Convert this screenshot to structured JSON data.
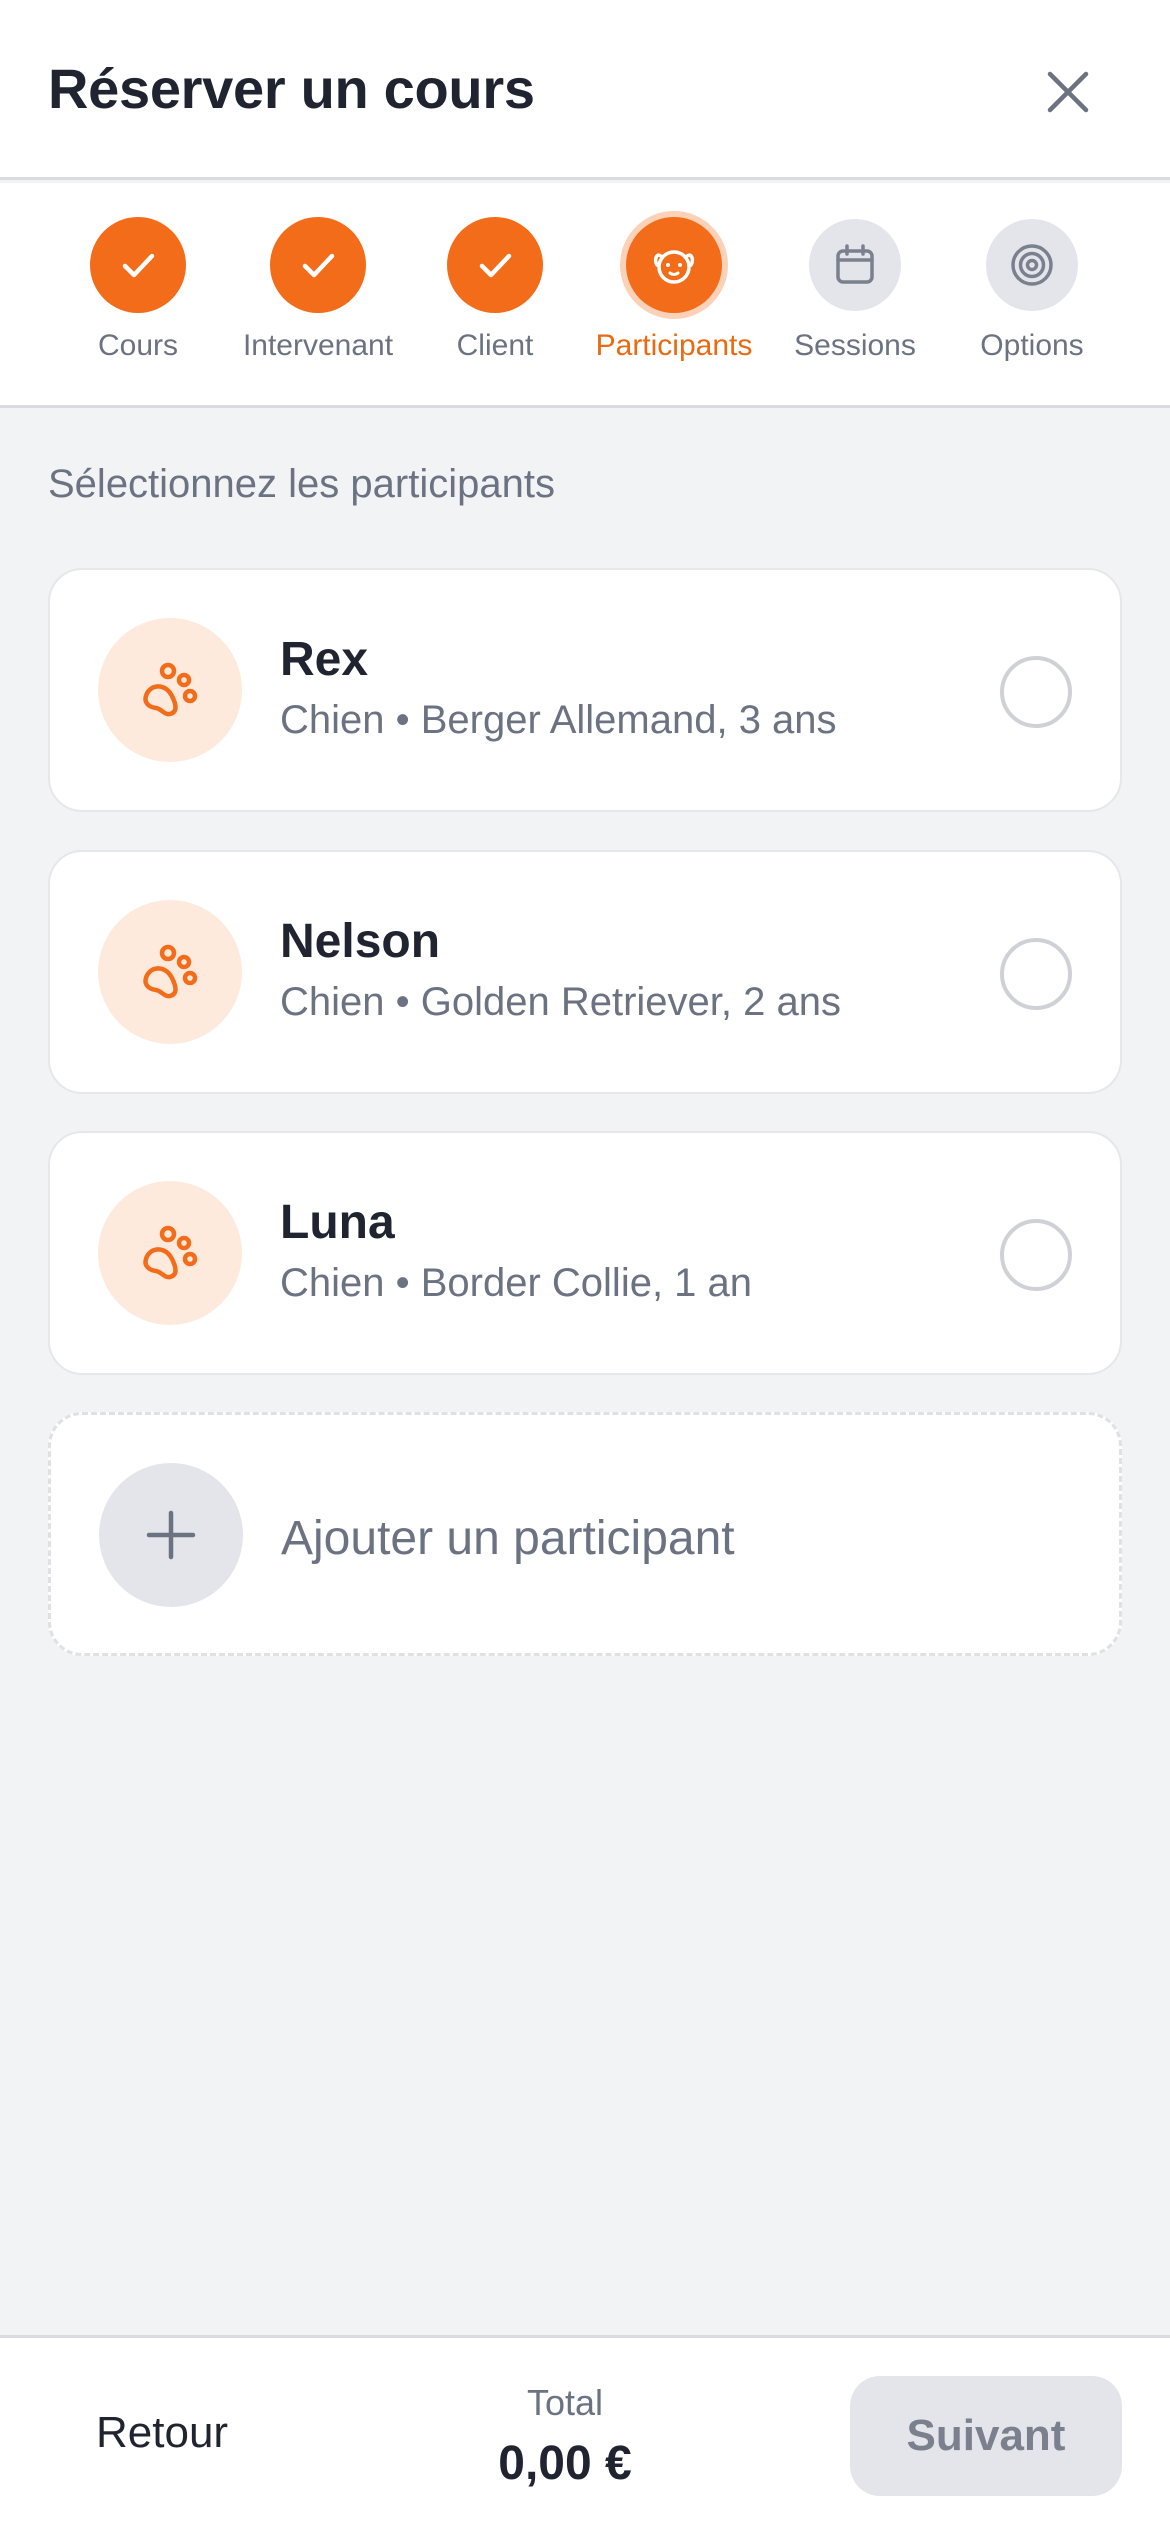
{
  "header": {
    "title": "Réserver un cours",
    "close_icon": "close-icon"
  },
  "stepper": {
    "steps": [
      {
        "label": "Cours",
        "state": "done",
        "icon": "check-icon"
      },
      {
        "label": "Intervenant",
        "state": "done",
        "icon": "check-icon"
      },
      {
        "label": "Client",
        "state": "done",
        "icon": "check-icon"
      },
      {
        "label": "Participants",
        "state": "current",
        "icon": "dog-face-icon"
      },
      {
        "label": "Sessions",
        "state": "todo",
        "icon": "calendar-icon"
      },
      {
        "label": "Options",
        "state": "todo",
        "icon": "target-icon"
      }
    ]
  },
  "main": {
    "section_title": "Sélectionnez les participants",
    "participants": [
      {
        "name": "Rex",
        "description": "Chien • Berger Allemand, 3 ans",
        "selected": false,
        "icon": "paw-icon"
      },
      {
        "name": "Nelson",
        "description": "Chien • Golden Retriever, 2 ans",
        "selected": false,
        "icon": "paw-icon"
      },
      {
        "name": "Luna",
        "description": "Chien • Border Collie, 1 an",
        "selected": false,
        "icon": "paw-icon"
      }
    ],
    "add_participant_label": "Ajouter un participant",
    "add_icon": "plus-icon"
  },
  "footer": {
    "back_label": "Retour",
    "total_label": "Total",
    "total_value": "0,00 €",
    "next_label": "Suivant"
  },
  "colors": {
    "accent": "#f26c1a",
    "accent_light": "#fdeadd",
    "muted_text": "#6b7282",
    "background": "#f2f3f5",
    "disabled_bg": "#e4e5ea"
  }
}
